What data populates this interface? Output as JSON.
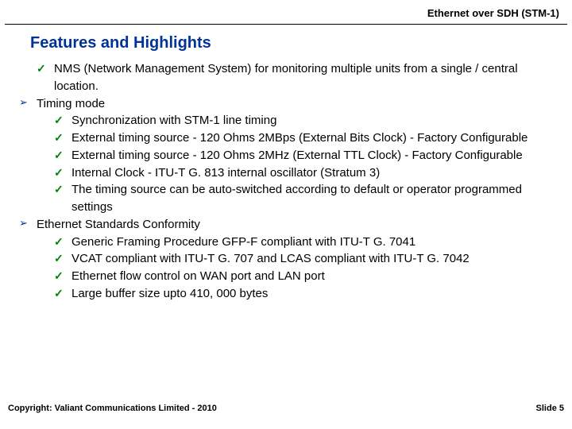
{
  "header": {
    "title": "Ethernet over SDH (STM-1)"
  },
  "section_title": "Features and Highlights",
  "bullets": {
    "top_check": "NMS (Network Management System) for monitoring multiple units from a single / central location.",
    "arrow1": "Timing mode",
    "a1_checks": [
      "Synchronization with STM-1 line timing",
      "External timing source - 120 Ohms 2MBps (External Bits Clock) - Factory Configurable",
      "External timing source - 120 Ohms 2MHz (External TTL Clock) - Factory Configurable",
      "Internal Clock - ITU-T G. 813 internal oscillator (Stratum 3)",
      "The timing source can be auto-switched according to default or operator programmed settings"
    ],
    "arrow2": "Ethernet Standards Conformity",
    "a2_checks": [
      "Generic Framing Procedure GFP-F compliant with ITU-T G. 7041",
      "VCAT compliant with ITU-T G. 707 and LCAS compliant with ITU-T G. 7042",
      "Ethernet flow control on WAN port and LAN port",
      "Large buffer size upto 410, 000 bytes"
    ]
  },
  "footer": {
    "copyright": "Copyright: Valiant Communications Limited - 2010",
    "slide": "Slide 5"
  }
}
